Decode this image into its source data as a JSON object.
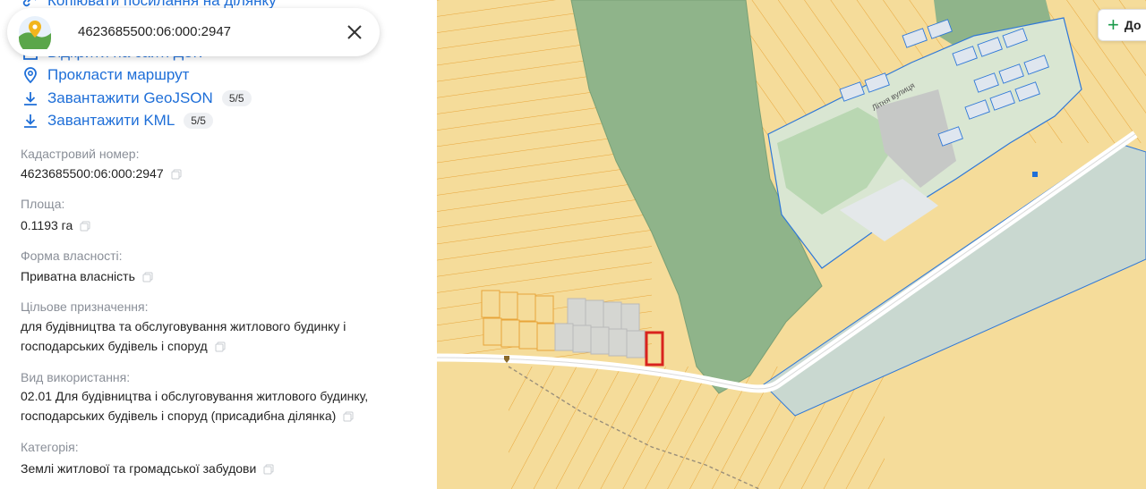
{
  "search": {
    "cadastral_number": "4623685500:06:000:2947"
  },
  "actions": {
    "top_hidden": "Копіювати посилання на ділянку",
    "open_site": "Відкрити на сайті ДЗК",
    "route": "Прокласти маршрут",
    "geojson": "Завантажити GeoJSON",
    "geojson_badge": "5/5",
    "kml": "Завантажити KML",
    "kml_badge": "5/5"
  },
  "fields": {
    "cad_label": "Кадастровий номер:",
    "cad_value": "4623685500:06:000:2947",
    "area_label": "Площа:",
    "area_value": "0.1193 га",
    "ownership_label": "Форма власності:",
    "ownership_value": "Приватна власність",
    "purpose_label": "Цільове призначення:",
    "purpose_value_1": "для будівництва та обслуговування житлового будинку і",
    "purpose_value_2": "господарських будівель і споруд",
    "usage_label": "Вид використання:",
    "usage_value_1": "02.01 Для будівництва і обслуговування житлового будинку,",
    "usage_value_2": "господарських будівель і споруд (присадибна ділянка)",
    "category_label": "Категорія:",
    "category_value": "Землі житлової та громадської забудови"
  },
  "map": {
    "street_label": "Літня вулиця",
    "add_button_label": "До",
    "colors": {
      "parcel_fill": "#f5dc9a",
      "parcel_line": "#e8a53a",
      "forest": "#8fb48a",
      "selected": "#d9231e",
      "blue_line": "#2f78d8",
      "road": "#ffffff",
      "highway_fill": "#c9d8d0"
    }
  }
}
